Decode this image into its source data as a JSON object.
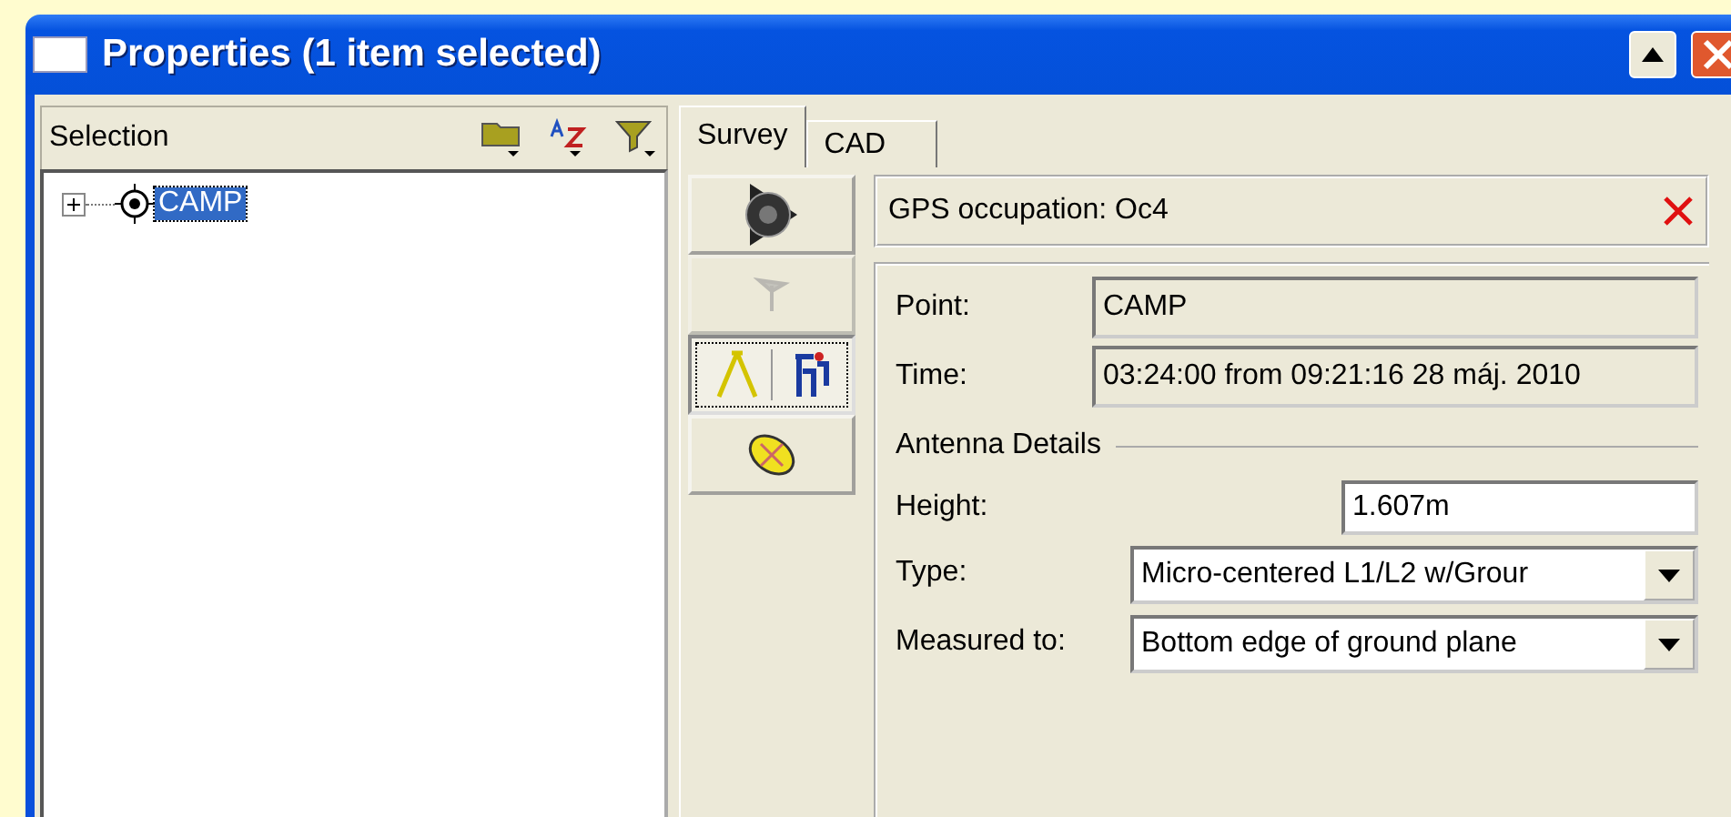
{
  "window": {
    "title": "Properties (1 item selected)"
  },
  "selection": {
    "title": "Selection",
    "tree": [
      {
        "label": "CAMP",
        "expanded": false,
        "selected": true
      }
    ]
  },
  "tabs": [
    {
      "label": "Survey",
      "selected": true
    },
    {
      "label": "CAD",
      "selected": false
    }
  ],
  "tool_buttons": [
    {
      "kind": "rose",
      "selected": false,
      "disabled": false
    },
    {
      "kind": "flag",
      "selected": false,
      "disabled": true
    },
    {
      "kind": "tripod",
      "selected": true,
      "disabled": false
    },
    {
      "kind": "antenna",
      "selected": false,
      "disabled": false
    }
  ],
  "occupation": {
    "title": "GPS occupation: Oc4",
    "fields": [
      {
        "label": "Point:",
        "value": "CAMP"
      },
      {
        "label": "Time:",
        "value": "03:24:00 from 09:21:16 28 máj. 2010"
      }
    ],
    "section": "Antenna Details",
    "height": {
      "label": "Height:",
      "value": "1.607m"
    },
    "dropdowns": [
      {
        "label": "Type:",
        "value": "Micro-centered L1/L2 w/Grour"
      },
      {
        "label": "Measured to:",
        "value": "Bottom edge of ground plane"
      }
    ]
  }
}
